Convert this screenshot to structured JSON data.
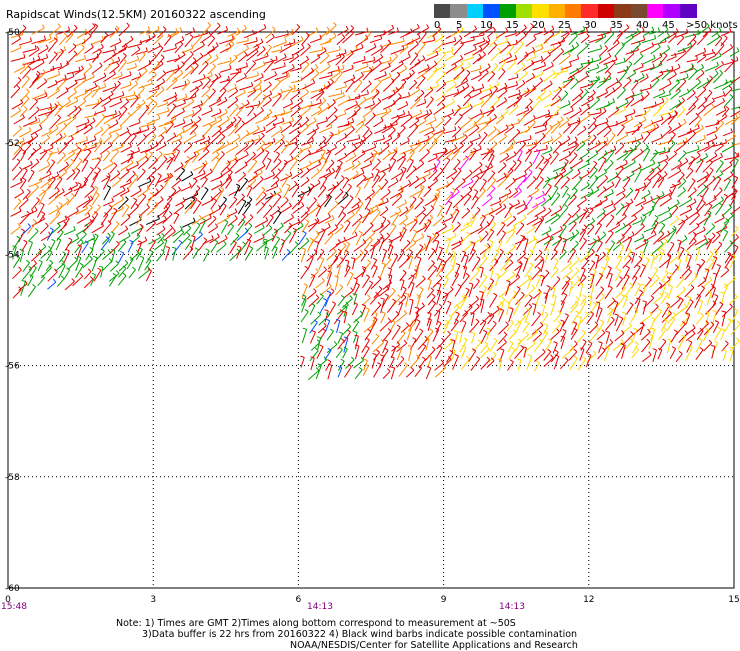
{
  "title": "Rapidscat Winds(12.5KM) 20160322 ascending",
  "colorbar": {
    "labels": [
      "0",
      "5",
      "10",
      "15",
      "20",
      "25",
      "30",
      "35",
      "40",
      "45",
      ">50 knots"
    ],
    "colors": [
      "#4a4a4a",
      "#8c8c8c",
      "#00d0ff",
      "#0050ff",
      "#00a000",
      "#a0e000",
      "#ffe000",
      "#ffb000",
      "#ff7a00",
      "#ff2a2a",
      "#d00000",
      "#8b3a1a",
      "#7a4a30",
      "#ff00ff",
      "#b000ff",
      "#6000c0"
    ]
  },
  "map": {
    "lat_labels": [
      "-50",
      "-52",
      "-54",
      "-56",
      "-58",
      "-60"
    ],
    "lon_labels": [
      "0",
      "3",
      "6",
      "9",
      "12",
      "15"
    ],
    "time_labels": [
      "15:48",
      "14:13",
      "14:13"
    ],
    "barb_colors": {
      "green": "#00a000",
      "yellow": "#ffd800",
      "orange": "#ff8800",
      "red": "#e60000",
      "magenta": "#ff00ff",
      "blue": "#0050ff",
      "black": "#000000"
    }
  },
  "notes": [
    "Note: 1) Times are GMT 2)Times along bottom correspond to measurement at ~50S",
    "3)Data buffer is 22 hrs from 20160322 4) Black wind barbs indicate possible contamination",
    "NOAA/NESDIS/Center for Satellite Applications and Research"
  ]
}
